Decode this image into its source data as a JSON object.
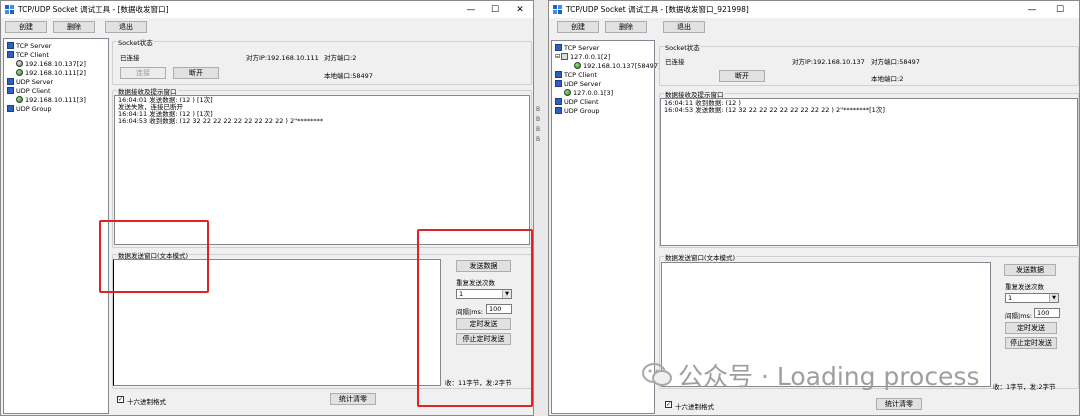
{
  "left_window": {
    "title": "TCP/UDP Socket 调试工具 - [数据收发窗口]",
    "toolbar": {
      "create": "创建",
      "delete": "删除",
      "exit": "退出"
    },
    "tree": [
      {
        "label": "TCP Server",
        "icon": "folder-icon"
      },
      {
        "label": "TCP Client",
        "icon": "folder-icon"
      },
      {
        "label": "192.168.10.137[2]",
        "icon": "status-gray-icon"
      },
      {
        "label": "192.168.10.111[2]",
        "icon": "status-green-icon"
      },
      {
        "label": "UDP Server",
        "icon": "folder-icon"
      },
      {
        "label": "UDP Client",
        "icon": "folder-icon"
      },
      {
        "label": "192.168.10.111[3]",
        "icon": "status-green-icon"
      },
      {
        "label": "UDP Group",
        "icon": "folder-icon"
      }
    ],
    "socket_group": "Socket状态",
    "connected": "已连接",
    "peer_ip": "对方IP:192.168.10.111",
    "peer_port": "对方端口:2",
    "local_port": "本地端口:58497",
    "connect_btn": "连接",
    "disconnect_btn": "断开",
    "recv_group": "数据接收及提示窗口",
    "recv_lines": [
      "16:04:01 发送数据: (12 ) [1次]",
      "发送失败，连接已断开",
      "16:04:11 发送数据: (12 ) [1次]",
      "16:04:53 收到数据: (12 32 22 22 22 22 22 22 22 22 ) 2\"********"
    ],
    "send_group": "数据发送窗口(文本模式)",
    "send_text": "",
    "send_btn": "发送数据",
    "repeat_label": "重复发送次数",
    "repeat_value": "1",
    "interval_label": "间隔|ms:",
    "interval_value": "100",
    "timed_send_btn": "定时发送",
    "stop_timed_btn": "停止定时发送",
    "status": "收：11字节，发:2字节",
    "hex_label": "十六进制格式",
    "stats_clear_btn": "统计清零"
  },
  "right_window": {
    "title": "TCP/UDP Socket 调试工具 - [数据收发窗口_921998]",
    "toolbar": {
      "create": "创建",
      "delete": "删除",
      "exit": "退出"
    },
    "tree": [
      {
        "label": "TCP Server",
        "icon": "folder-icon"
      },
      {
        "label": "127.0.0.1[2]",
        "icon": "computer-icon"
      },
      {
        "label": "192.168.10.137[58497]",
        "icon": "status-green-icon"
      },
      {
        "label": "TCP Client",
        "icon": "folder-icon"
      },
      {
        "label": "UDP Server",
        "icon": "folder-icon"
      },
      {
        "label": "127.0.0.1[3]",
        "icon": "status-green-icon"
      },
      {
        "label": "UDP Client",
        "icon": "folder-icon"
      },
      {
        "label": "UDP Group",
        "icon": "folder-icon"
      }
    ],
    "socket_group": "Socket状态",
    "connected": "已连接",
    "peer_ip": "对方IP:192.168.10.137",
    "peer_port": "对方端口:58497",
    "local_port": "本地端口:2",
    "disconnect_btn": "断开",
    "recv_group": "数据接收及提示窗口",
    "recv_lines": [
      "16:04:11 收到数据: (12 )",
      "16:04:53 发送数据: (12 32 22 22 22 22 22 22 22 22 ) 2\"********[1次]"
    ],
    "send_group": "数据发送窗口(文本模式)",
    "send_btn": "发送数据",
    "repeat_label": "重复发送次数",
    "repeat_value": "1",
    "interval_label": "间隔|ms:",
    "interval_value": "100",
    "timed_send_btn": "定时发送",
    "stop_timed_btn": "停止定时发送",
    "status": "收：1字节，发:2字节",
    "hex_label": "十六进制格式",
    "stats_clear_btn": "统计清零"
  },
  "watermark": {
    "text": "公众号 · Loading process"
  },
  "colors": {
    "annotation_red": "#e02424",
    "desktop": "#0c2f6e"
  }
}
